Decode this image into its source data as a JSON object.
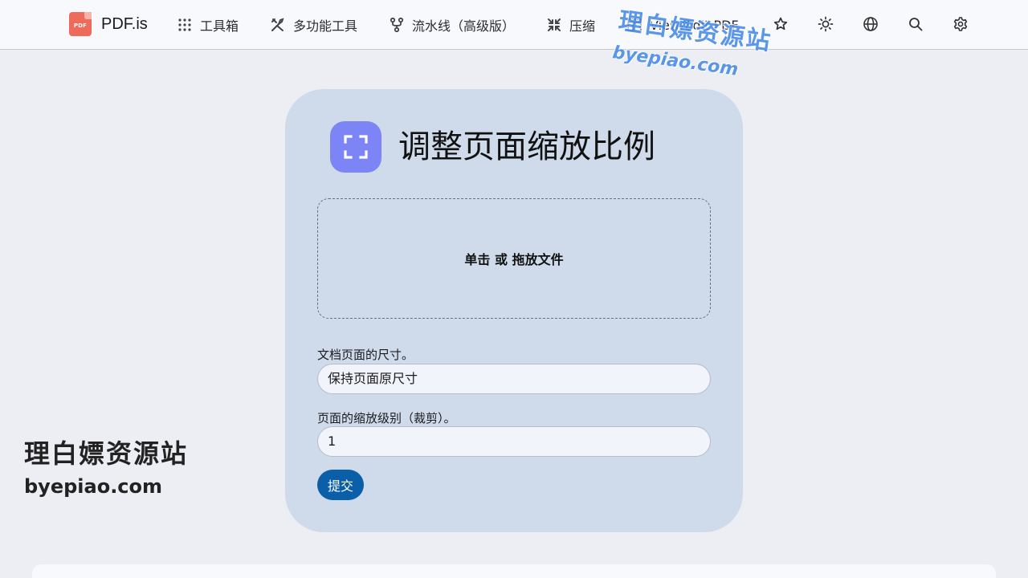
{
  "nav": {
    "brand": "PDF.is",
    "items": [
      {
        "label": "工具箱",
        "icon": "grid-dots-icon"
      },
      {
        "label": "多功能工具",
        "icon": "tools-icon"
      },
      {
        "label": "流水线（高级版）",
        "icon": "pipeline-icon"
      },
      {
        "label": "压缩",
        "icon": "compress-icon"
      },
      {
        "label": "View/Edit PDF",
        "icon": "view-edit-icon"
      }
    ],
    "icon_buttons": [
      "star-icon",
      "sun-icon",
      "globe-icon",
      "search-icon",
      "gear-icon"
    ]
  },
  "watermark": {
    "cn": "理白嫖资源站",
    "en": "byepiao.com"
  },
  "tool": {
    "title": "调整页面缩放比例",
    "icon": "fullscreen-frame-icon",
    "dropzone_text": "单击 或 拖放文件",
    "page_size_label": "文档页面的尺寸。",
    "page_size_value": "保持页面原尺寸",
    "scale_label": "页面的缩放级别（裁剪）。",
    "scale_value": "1",
    "submit_label": "提交"
  },
  "colors": {
    "card_bg": "#cfdbea",
    "tool_icon_bg": "#7d84f5",
    "submit_bg": "#0b5fa8",
    "logo_bg": "#ee6b5c",
    "watermark": "#4a8de8"
  }
}
